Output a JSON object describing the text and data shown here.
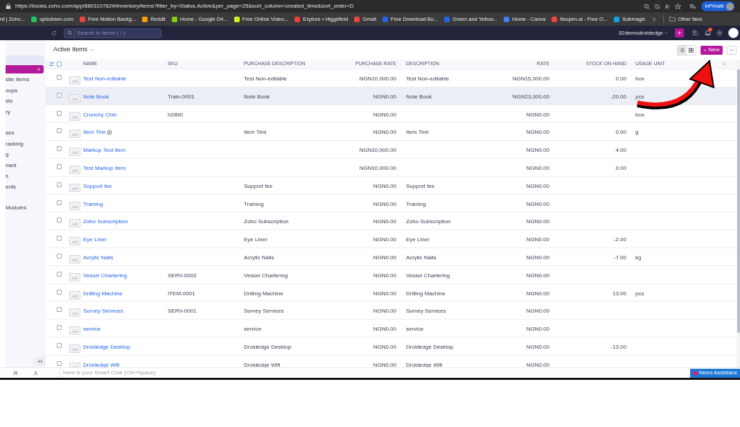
{
  "browser": {
    "url": "https://books.zoho.com/app/880110762#/inventory/items?filter_by=Status.Active&per_page=25&sort_column=created_time&sort_order=D",
    "profile": "InPrivate",
    "bookmarks": [
      {
        "label": "rd | Zoho..."
      },
      {
        "label": "uptodown.com"
      },
      {
        "label": "Free Motion Backg..."
      },
      {
        "label": "Reddit"
      },
      {
        "label": "Home - Google Dri..."
      },
      {
        "label": "Free Online Video..."
      },
      {
        "label": "Explore • Higgsfield"
      },
      {
        "label": "Gmail"
      },
      {
        "label": "Free Download Bo..."
      },
      {
        "label": "Green and Yellow..."
      },
      {
        "label": "Home - Canva"
      },
      {
        "label": "ttsopen.ai - Free O..."
      },
      {
        "label": "Submagic"
      }
    ],
    "other_bookmarks": "Other favo"
  },
  "app_bar": {
    "search_placeholder": "Search in Items ( / )",
    "organization": "32demodroidedge"
  },
  "sidebar": {
    "items": [
      {
        "label": "site Items"
      },
      {
        "label": "oups"
      },
      {
        "label": "sts"
      },
      {
        "label": "ry"
      },
      {
        "label": "ses"
      },
      {
        "label": "racking"
      },
      {
        "label": "g"
      },
      {
        "label": "riant"
      },
      {
        "label": "s"
      },
      {
        "label": "ents"
      },
      {
        "label": "Modules"
      }
    ]
  },
  "header": {
    "title": "Active Items",
    "new_button": "New",
    "view_buttons": [
      {
        "kind": "list",
        "selected": true
      },
      {
        "kind": "grid",
        "selected": false
      }
    ]
  },
  "table": {
    "select_all_checked": false,
    "columns": [
      "NAME",
      "SKU",
      "PURCHASE DESCRIPTION",
      "PURCHASE RATE",
      "DESCRIPTION",
      "RATE",
      "STOCK ON HAND",
      "USAGE UNIT"
    ],
    "rows": [
      {
        "name": "Test Non-editable",
        "sku": "",
        "purchase_description": "Test Non-editable",
        "purchase_rate": "NGN10,000.00",
        "description": "Test Non-editable",
        "rate": "NGN15,000.00",
        "stock_on_hand": "0.00",
        "usage_unit": "box",
        "selected": false,
        "has_icon": false
      },
      {
        "name": "Note Book",
        "sku": "Train-0001",
        "purchase_description": "Note Book",
        "purchase_rate": "NGN0.00",
        "description": "Note Book",
        "rate": "NGN23,000.00",
        "stock_on_hand": "-20.00",
        "usage_unit": "pcs",
        "selected": true,
        "has_icon": false
      },
      {
        "name": "Crunchy Chin",
        "sku": "h2890",
        "purchase_description": "",
        "purchase_rate": "NGN0.00",
        "description": "",
        "rate": "NGN0.00",
        "stock_on_hand": "",
        "usage_unit": "box",
        "selected": false,
        "has_icon": false
      },
      {
        "name": "Item Timi",
        "sku": "",
        "purchase_description": "Item Timi",
        "purchase_rate": "NGN0.00",
        "description": "Item Timi",
        "rate": "NGN0.00",
        "stock_on_hand": "0.00",
        "usage_unit": "g",
        "selected": false,
        "has_icon": true
      },
      {
        "name": "Markup Test Item",
        "sku": "",
        "purchase_description": "",
        "purchase_rate": "NGN10,000.00",
        "description": "",
        "rate": "NGN0.00",
        "stock_on_hand": "4.00",
        "usage_unit": "",
        "selected": false,
        "has_icon": false
      },
      {
        "name": "Test Markup Item",
        "sku": "",
        "purchase_description": "",
        "purchase_rate": "NGN10,000.00",
        "description": "",
        "rate": "NGN0.00",
        "stock_on_hand": "0.00",
        "usage_unit": "",
        "selected": false,
        "has_icon": false
      },
      {
        "name": "Support fee",
        "sku": "",
        "purchase_description": "Support fee",
        "purchase_rate": "NGN0.00",
        "description": "Support fee",
        "rate": "NGN0.00",
        "stock_on_hand": "",
        "usage_unit": "",
        "selected": false,
        "has_icon": false
      },
      {
        "name": "Training",
        "sku": "",
        "purchase_description": "Training",
        "purchase_rate": "NGN0.00",
        "description": "Training",
        "rate": "NGN0.00",
        "stock_on_hand": "",
        "usage_unit": "",
        "selected": false,
        "has_icon": false
      },
      {
        "name": "Zoho Subscription",
        "sku": "",
        "purchase_description": "Zoho Subscription",
        "purchase_rate": "NGN0.00",
        "description": "Zoho Subscription",
        "rate": "NGN0.00",
        "stock_on_hand": "",
        "usage_unit": "",
        "selected": false,
        "has_icon": false
      },
      {
        "name": "Eye Liner",
        "sku": "",
        "purchase_description": "Eye Liner",
        "purchase_rate": "NGN0.00",
        "description": "Eye Liner",
        "rate": "NGN0.00",
        "stock_on_hand": "-2.00",
        "usage_unit": "",
        "selected": false,
        "has_icon": false
      },
      {
        "name": "Acrylic Nails",
        "sku": "",
        "purchase_description": "Acrylic Nails",
        "purchase_rate": "NGN0.00",
        "description": "Acrylic Nails",
        "rate": "NGN0.00",
        "stock_on_hand": "-7.00",
        "usage_unit": "kg",
        "selected": false,
        "has_icon": false
      },
      {
        "name": "Vessel Chartering",
        "sku": "SERV-0002",
        "purchase_description": "Vessel Chartering",
        "purchase_rate": "NGN0.00",
        "description": "Vessel Chartering",
        "rate": "NGN0.00",
        "stock_on_hand": "",
        "usage_unit": "",
        "selected": false,
        "has_icon": false
      },
      {
        "name": "Drilling Machine",
        "sku": "ITEM-0001",
        "purchase_description": "Drilling Machine",
        "purchase_rate": "NGN0.00",
        "description": "Drilling Machine",
        "rate": "NGN0.00",
        "stock_on_hand": "13.00",
        "usage_unit": "pcs",
        "selected": false,
        "has_icon": false
      },
      {
        "name": "Survey Services",
        "sku": "SERV-0001",
        "purchase_description": "Survey Services",
        "purchase_rate": "NGN0.00",
        "description": "Survey Services",
        "rate": "NGN0.00",
        "stock_on_hand": "",
        "usage_unit": "",
        "selected": false,
        "has_icon": false
      },
      {
        "name": "service",
        "sku": "",
        "purchase_description": "service",
        "purchase_rate": "NGN0.00",
        "description": "service",
        "rate": "NGN0.00",
        "stock_on_hand": "",
        "usage_unit": "",
        "selected": false,
        "has_icon": false
      },
      {
        "name": "Droidedge Desktop",
        "sku": "",
        "purchase_description": "Droidedge Desktop",
        "purchase_rate": "NGN0.00",
        "description": "Droidedge Desktop",
        "rate": "NGN0.00",
        "stock_on_hand": "-13.00",
        "usage_unit": "",
        "selected": false,
        "has_icon": false
      },
      {
        "name": "Droidedge Wifi",
        "sku": "",
        "purchase_description": "Droidedge Wifi",
        "purchase_rate": "NGN0.00",
        "description": "Droidedge Wifi",
        "rate": "NGN0.00",
        "stock_on_hand": "",
        "usage_unit": "",
        "selected": false,
        "has_icon": false
      }
    ]
  },
  "smart_chat": {
    "placeholder": "Here is your Smart Chat (Ctrl+Space)"
  },
  "assistance_button": "Need Assistanc"
}
